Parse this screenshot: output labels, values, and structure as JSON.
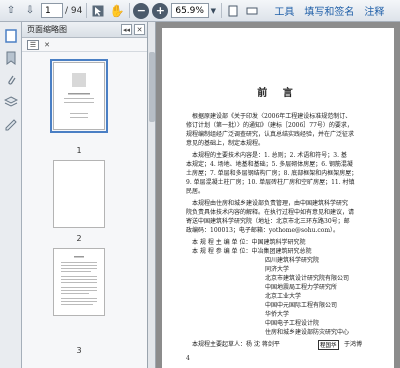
{
  "toolbar": {
    "page_current": "1",
    "page_total": "/ 94",
    "zoom": "65.9%",
    "menu_tools": "工具",
    "menu_sign": "填写和签名",
    "menu_comment": "注释"
  },
  "thumb_panel": {
    "title": "页面缩略图",
    "pages": [
      "1",
      "2",
      "3"
    ]
  },
  "document": {
    "title": "前 言",
    "paragraphs": [
      "根据原建设部《关于印发〈2006年工程建设标准规范制订、",
      "修订计划（第一批）〉的通知》（建标［2006］77号）的要求，",
      "规程编制组经广泛调查研究，认真总结实践经验，并在广泛征求",
      "意见的基础上，制定本规程。",
      "本规程的主要技术内容是：1. 总则；2. 术语和符号；3. 基",
      "本规定；4. 场地、地基和基础；5. 多层砌体房屋；6. 钢筋混凝",
      "土房屋；7. 单层和多层钢结构厂房；8. 底部框架和内框架房屋；",
      "9. 单层混凝土柱厂房；10. 单层砖柱厂房和空旷房屋；11. 村镇",
      "民居。",
      "本规程由住房和城乡建设部负责管理，由中国建筑科学研究",
      "院负责具体技术内容的解释。在执行过程中如有意见和建议，请",
      "寄送中国建筑科学研究院（地址：北京市北三环东路30号；邮",
      "政编码：100013；电子邮箱：yothome@sohu.com）。",
      "本 规 程 主 编 单 位：中国建筑科学研究院",
      "本 规 程 参 编 单 位：中冶集团建筑研究总院",
      "四川建筑科学研究院",
      "同济大学",
      "北京市建筑设计研究院有限公司",
      "中国地震局工程力学研究所",
      "北京工业大学",
      "中国中元国际工程有限公司",
      "华侨大学",
      "中国电子工程设计院",
      "住房和城乡建设部防灾研究中心",
      "本规程主要起草人：杨 沈 蒋剑平"
    ],
    "stamp": "程国华",
    "last_name": "于鸿博",
    "page_number": "4"
  }
}
